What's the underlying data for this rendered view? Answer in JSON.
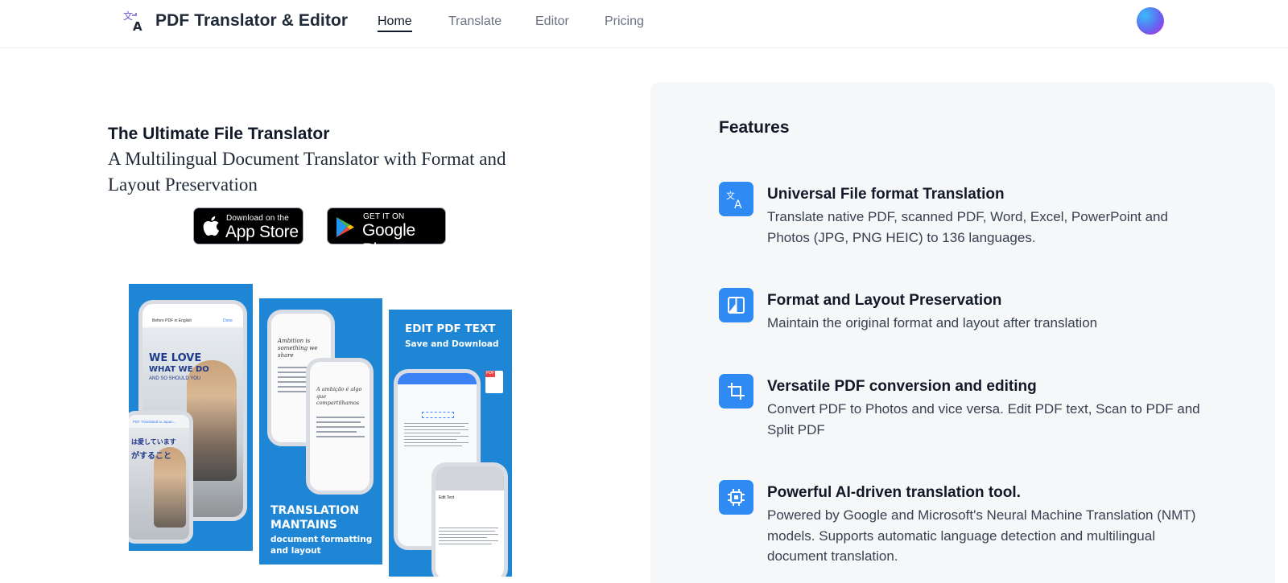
{
  "header": {
    "brand": "PDF Translator & Editor",
    "nav": [
      "Home",
      "Translate",
      "Editor",
      "Pricing"
    ],
    "active": "Home"
  },
  "hero": {
    "title": "The Ultimate File Translator",
    "subtitle": "A Multilingual Document Translator with Format and Layout Preservation",
    "app_store": {
      "small": "Download on the",
      "big": "App Store"
    },
    "google_play": {
      "small": "GET IT ON",
      "big": "Google Play"
    }
  },
  "screens": {
    "shot1": {
      "before": "Before PDF in English",
      "done": "Done",
      "headline1": "WE LOVE",
      "headline2": "WHAT WE DO",
      "headline3": "AND SO SHOULD YOU",
      "translated": "PDF Translated to Japan...",
      "jp1": "は愛しています",
      "jp2": "がすること"
    },
    "shot2": {
      "phrase1": "Ambition is something we share",
      "phrase2": "A ambição é algo que compartilhamos",
      "caption1": "TRANSLATION",
      "caption2": "MANTAINS",
      "caption3": "document formatting",
      "caption4": "and layout"
    },
    "shot3": {
      "caption1": "EDIT PDF TEXT",
      "caption2": "Save and Download",
      "edit_text": "Edit Text"
    }
  },
  "features": {
    "title": "Features",
    "items": [
      {
        "icon": "translate-icon",
        "title": "Universal File format Translation",
        "desc": "Translate native PDF, scanned PDF, Word, Excel, PowerPoint and Photos (JPG, PNG HEIC) to 136 languages."
      },
      {
        "icon": "layout-icon",
        "title": "Format and Layout Preservation",
        "desc": "Maintain the original format and layout after translation"
      },
      {
        "icon": "crop-icon",
        "title": "Versatile PDF conversion and editing",
        "desc": "Convert PDF to Photos and vice versa. Edit PDF text, Scan to PDF and Split PDF"
      },
      {
        "icon": "chip-icon",
        "title": "Powerful AI-driven translation tool.",
        "desc": "Powered by Google and Microsoft's Neural Machine Translation (NMT) models. Supports automatic language detection and multilingual document translation."
      }
    ]
  },
  "colors": {
    "accent": "#2f8bf3",
    "panel": "#f6f7f8",
    "shot_blue": "#1f86d6"
  }
}
